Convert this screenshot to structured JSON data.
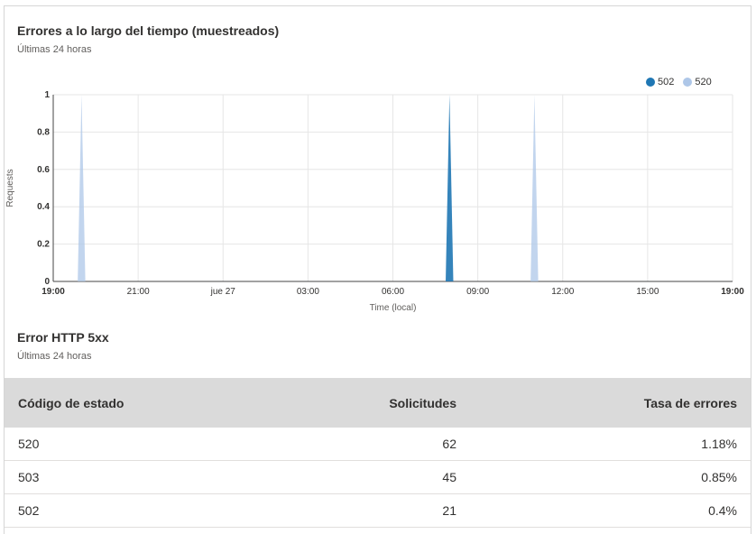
{
  "chart_section": {
    "title": "Errores a lo largo del tiempo (muestreados)",
    "subtitle": "Últimas 24 horas"
  },
  "chart_data": {
    "type": "area",
    "ylabel": "Requests",
    "xlabel": "Time (local)",
    "ylim": [
      0,
      1
    ],
    "y_ticks": [
      "0",
      "0.2",
      "0.4",
      "0.6",
      "0.8",
      "1"
    ],
    "x_ticks": [
      "19:00",
      "21:00",
      "jue 27",
      "03:00",
      "06:00",
      "09:00",
      "12:00",
      "15:00",
      "19:00"
    ],
    "x_range_hours": [
      0,
      24
    ],
    "grid": true,
    "legend_position": "top-right",
    "series": [
      {
        "name": "502",
        "color": "#1f77b4",
        "points": [
          {
            "x_hour": 14.0,
            "y": 1
          }
        ]
      },
      {
        "name": "520",
        "color": "#aec7e8",
        "points": [
          {
            "x_hour": 1.0,
            "y": 1
          },
          {
            "x_hour": 17.0,
            "y": 1
          }
        ]
      }
    ]
  },
  "table_section": {
    "title": "Error HTTP 5xx",
    "subtitle": "Últimas 24 horas",
    "columns": [
      "Código de estado",
      "Solicitudes",
      "Tasa de errores"
    ],
    "rows": [
      {
        "code": "520",
        "requests": "62",
        "rate": "1.18%"
      },
      {
        "code": "503",
        "requests": "45",
        "rate": "0.85%"
      },
      {
        "code": "502",
        "requests": "21",
        "rate": "0.4%"
      }
    ]
  }
}
